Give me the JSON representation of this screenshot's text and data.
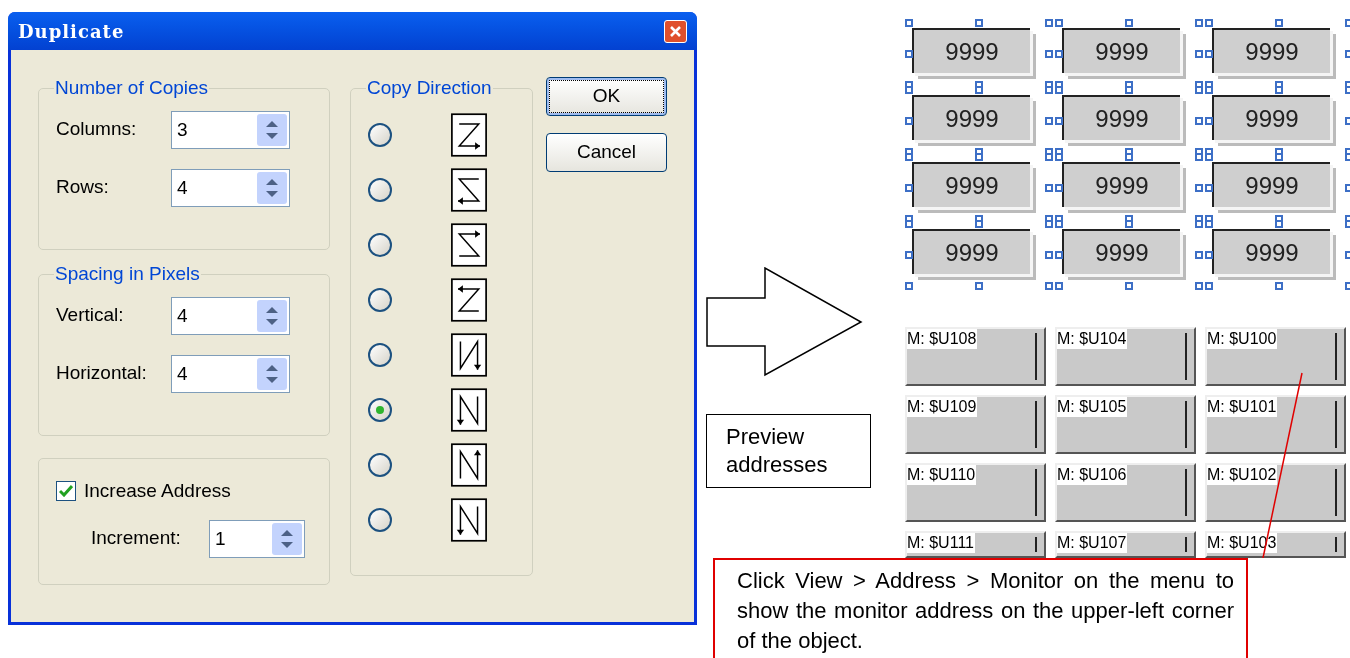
{
  "window": {
    "title": "Duplicate"
  },
  "number_of_copies": {
    "title": "Number of Copies",
    "fields": [
      {
        "label": "Columns:",
        "value": "3"
      },
      {
        "label": "Rows:",
        "value": "4"
      }
    ]
  },
  "spacing": {
    "title": "Spacing in Pixels",
    "fields": [
      {
        "label": "Vertical:",
        "value": "4"
      },
      {
        "label": "Horizontal:",
        "value": "4"
      }
    ]
  },
  "increase_address": {
    "label": "Increase Address",
    "checked": true,
    "increment": {
      "label": "Increment:",
      "value": "1"
    }
  },
  "copy_direction": {
    "title": "Copy Direction",
    "options": [
      {
        "kind": "row-right-down",
        "selected": false
      },
      {
        "kind": "row-left-down",
        "selected": false
      },
      {
        "kind": "row-right-up",
        "selected": false
      },
      {
        "kind": "row-left-up",
        "selected": false
      },
      {
        "kind": "col-down-right",
        "selected": false
      },
      {
        "kind": "col-down-left",
        "selected": true
      },
      {
        "kind": "col-up-right",
        "selected": false
      },
      {
        "kind": "col-down-left",
        "selected": false
      }
    ]
  },
  "buttons": [
    {
      "label": "OK",
      "focused": true
    },
    {
      "label": "Cancel",
      "focused": false
    }
  ],
  "canvas": {
    "grid": [
      [
        "9999",
        "9999",
        "9999"
      ],
      [
        "9999",
        "9999",
        "9999"
      ],
      [
        "9999",
        "9999",
        "9999"
      ],
      [
        "9999",
        "9999",
        "9999"
      ]
    ],
    "preview": [
      [
        "M: $U108",
        "M: $U104",
        "M: $U100"
      ],
      [
        "M: $U109",
        "M: $U105",
        "M: $U101"
      ],
      [
        "M: $U110",
        "M: $U106",
        "M: $U102"
      ],
      [
        "M: $U111",
        "M: $U107",
        "M: $U103"
      ]
    ],
    "preview_note": "Preview addresses",
    "callout": "Click View > Address > Monitor on the menu to show the monitor address on the upper-left corner of the object."
  }
}
